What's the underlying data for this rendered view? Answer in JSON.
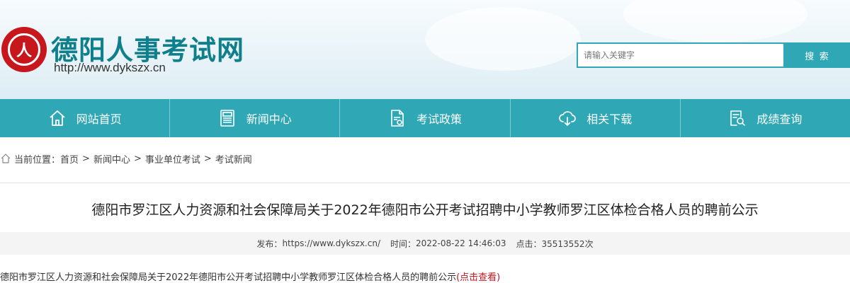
{
  "header": {
    "seal_text": "人",
    "site_title": "德阳人事考试网",
    "site_url": "http://www.dykszx.cn"
  },
  "search": {
    "placeholder": "请输入关键字",
    "button_label": "搜 索"
  },
  "nav": {
    "items": [
      {
        "label": "网站首页",
        "icon": "home-icon"
      },
      {
        "label": "新闻中心",
        "icon": "newspaper-icon"
      },
      {
        "label": "考试政策",
        "icon": "policy-document-icon"
      },
      {
        "label": "相关下载",
        "icon": "cloud-download-icon"
      },
      {
        "label": "成绩查询",
        "icon": "search-document-icon"
      }
    ]
  },
  "breadcrumb": {
    "prefix": "当前位置：",
    "items": [
      "首页",
      "新闻中心",
      "事业单位考试",
      "考试新闻"
    ],
    "separator": ">"
  },
  "article": {
    "title": "德阳市罗江区人力资源和社会保障局关于2022年德阳市公开考试招聘中小学教师罗江区体检合格人员的聘前公示",
    "meta": {
      "publisher_label": "发布：",
      "publisher": "https://www.dykszx.cn/",
      "time_label": "时间：",
      "time": "2022-08-22 14:46:03",
      "hits_label": "点击：",
      "hits": "35513552次"
    },
    "body_text": "德阳市罗江区人力资源和社会保障局关于2022年德阳市公开考试招聘中小学教师罗江区体检合格人员的聘前公示",
    "body_link": "(点击查看)"
  },
  "colors": {
    "accent": "#2fa7b5",
    "brand_title": "#0f7f8c",
    "seal_red": "#c8161d",
    "link_red": "#c8161d"
  }
}
